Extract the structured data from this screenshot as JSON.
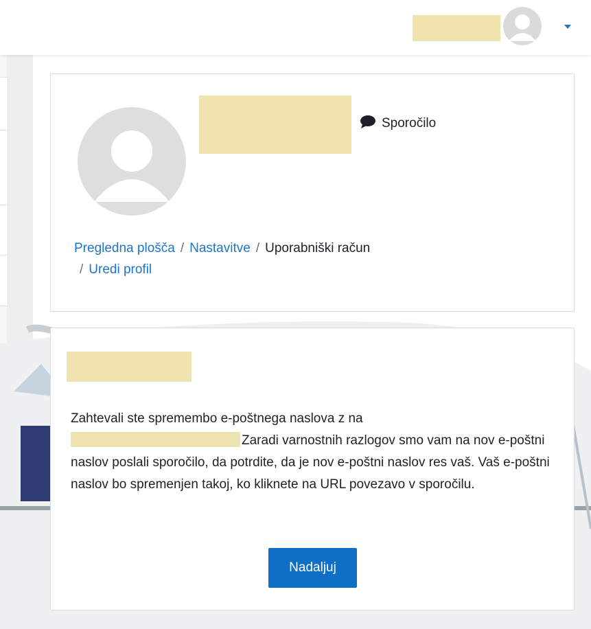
{
  "header": {
    "message_label": "Sporočilo",
    "breadcrumb": [
      {
        "label": "Pregledna plošča"
      },
      {
        "label": "Nastavitve"
      },
      {
        "label": "Uporabniški račun"
      },
      {
        "label": "Uredi profil"
      }
    ],
    "breadcrumb_separator": "/"
  },
  "notice": {
    "text_before_email": "Zahtevali ste spremembo e-poštnega naslova z na",
    "text_after_email": "Zaradi varnostnih razlogov smo vam na nov e-poštni naslov poslali sporočilo, da potrdite, da je nov e-poštni naslov res vaš. Vaš e-poštni naslov bo spremenjen takoj, ko kliknete na URL povezavo v sporočilu.",
    "continue_label": "Nadaljuj"
  },
  "colors": {
    "link": "#1f74c6",
    "primary_button": "#0f6fc5",
    "redaction": "#efe4b0"
  },
  "icons": {
    "user_avatar": "user-avatar-icon",
    "dropdown": "caret-down-icon",
    "message": "speech-bubble-icon",
    "profile_picture": "default-avatar-icon"
  }
}
